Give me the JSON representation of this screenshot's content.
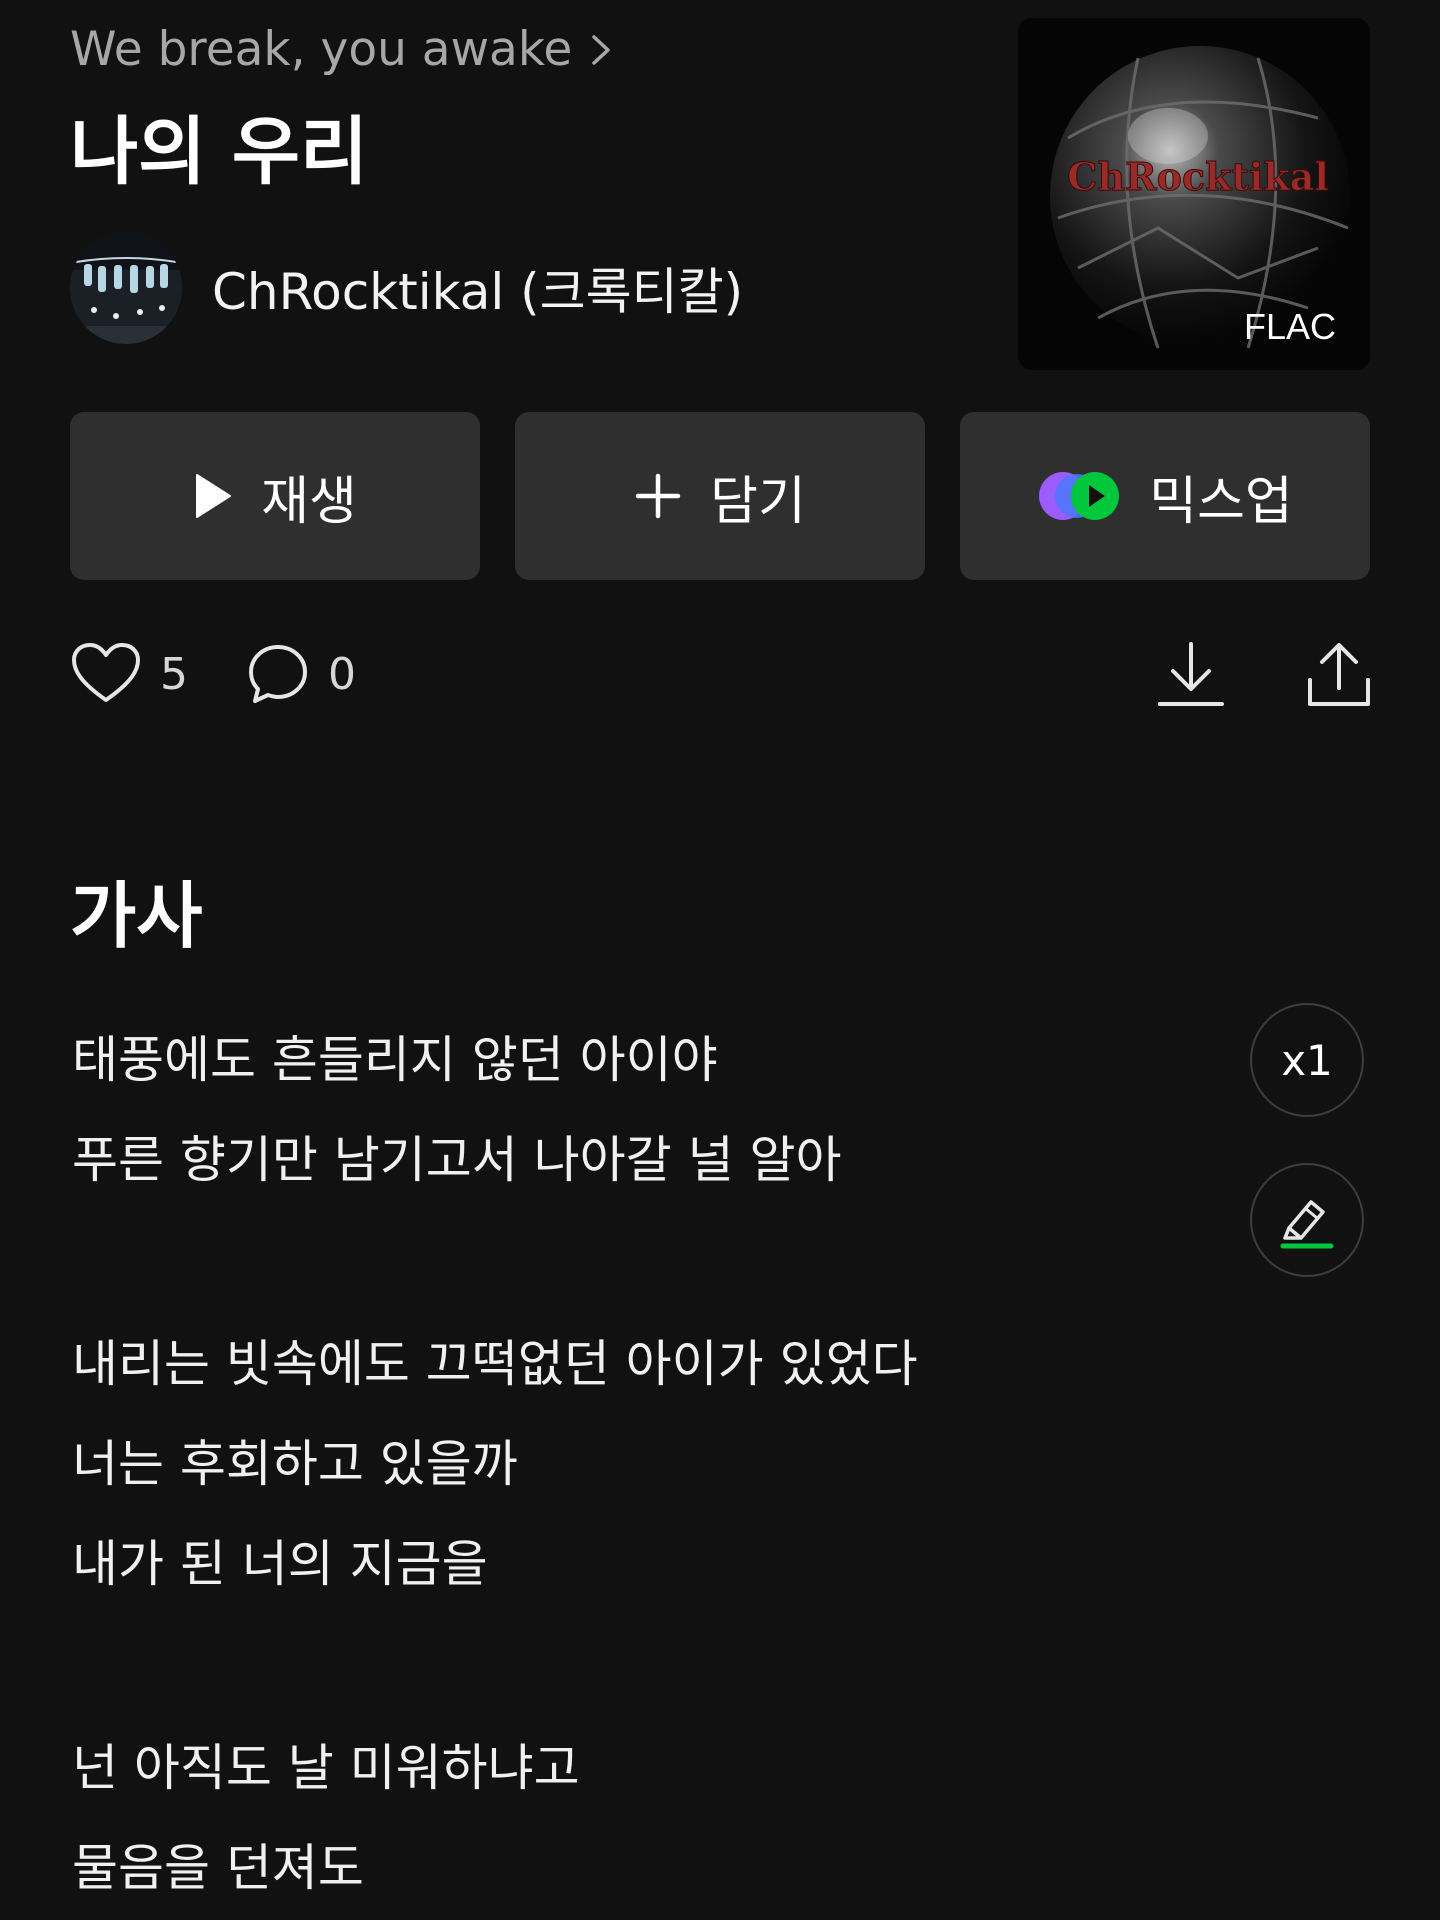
{
  "header": {
    "album_name": "We break, you awake",
    "song_title": "나의 우리",
    "artist": "ChRocktikal (크록티칼)"
  },
  "cover": {
    "art_text": "ChRocktikal",
    "quality_badge": "FLAC"
  },
  "actions": {
    "play_label": "재생",
    "add_label": "담기",
    "mixup_label": "믹스업"
  },
  "stats": {
    "likes": "5",
    "comments": "0"
  },
  "lyrics": {
    "heading": "가사",
    "speed_label": "x1",
    "stanzas": [
      [
        "태풍에도 흔들리지 않던 아이야",
        "푸른 향기만 남기고서 나아갈 널 알아"
      ],
      [
        "내리는 빗속에도 끄떡없던 아이가 있었다",
        "너는 후회하고 있을까",
        "내가 된 너의 지금을"
      ],
      [
        "넌 아직도 날 미워하냐고",
        "물음을 던져도"
      ]
    ]
  },
  "icons": {
    "album_chevron": "chevron-right-icon",
    "play": "play-icon",
    "add": "plus-icon",
    "mixup": "mixup-icon",
    "like": "heart-icon",
    "comment": "comment-icon",
    "download": "download-icon",
    "share": "share-icon",
    "highlight": "highlighter-icon"
  },
  "colors": {
    "background": "#111111",
    "button": "#2f2f2f",
    "secondary_text": "#a7a7a7",
    "accent_green": "#00c73c",
    "mixup_blue": "#4a78ff",
    "mixup_purple": "#9b5cff"
  }
}
